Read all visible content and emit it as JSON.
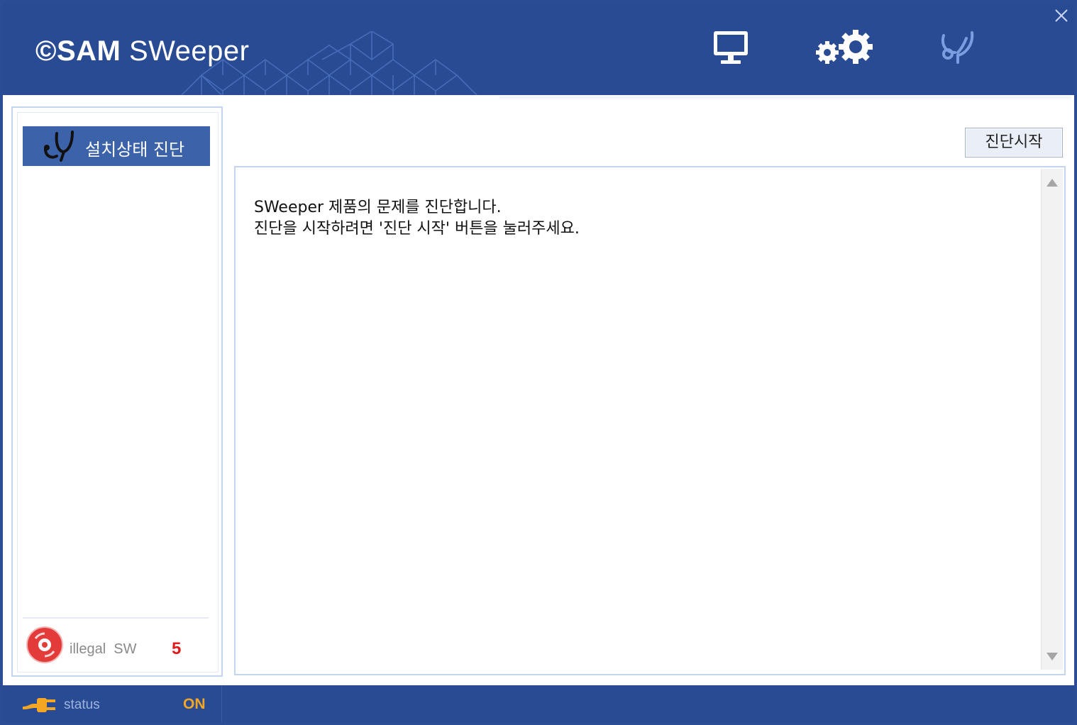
{
  "app": {
    "logo_prefix": "©SAM",
    "logo_suffix": " SWeeper"
  },
  "toolbar": {
    "icons": [
      "monitor-icon",
      "gears-icon",
      "stethoscope-icon"
    ],
    "close_icon": "close-icon"
  },
  "sidebar": {
    "items": [
      {
        "label": "설치상태 진단",
        "icon": "stethoscope-icon"
      }
    ],
    "illegal_sw": {
      "label": "illegal  SW",
      "count": "5",
      "icon": "disc-icon"
    }
  },
  "main": {
    "start_button_label": "진단시작",
    "messages": [
      "SWeeper 제품의 문제를 진단합니다.",
      "진단을 시작하려면 '진단 시작' 버튼을 눌러주세요."
    ]
  },
  "statusbar": {
    "label": "status",
    "value": "ON",
    "icon": "plug-icon"
  },
  "colors": {
    "header_bg": "#294b93",
    "menu_active_bg": "#3c63a9",
    "status_on": "#f5a623",
    "illegal_count": "#e21a1a"
  }
}
